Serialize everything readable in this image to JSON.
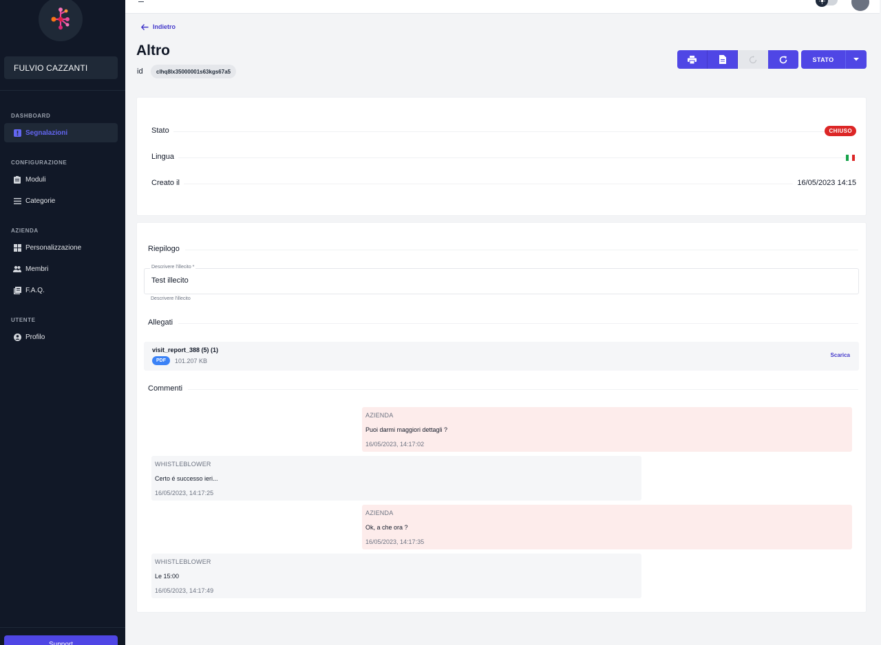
{
  "sidebar": {
    "user_name": "FULVIO CAZZANTI",
    "sections": [
      {
        "title": "DASHBOARD",
        "items": [
          {
            "label": "Segnalazioni",
            "icon": "alert-square-icon",
            "active": true
          }
        ]
      },
      {
        "title": "CONFIGURAZIONE",
        "items": [
          {
            "label": "Moduli",
            "icon": "clipboard-icon"
          },
          {
            "label": "Categorie",
            "icon": "list-icon"
          }
        ]
      },
      {
        "title": "AZIENDA",
        "items": [
          {
            "label": "Personalizzazione",
            "icon": "grid-icon"
          },
          {
            "label": "Membri",
            "icon": "users-icon"
          },
          {
            "label": "F.A.Q.",
            "icon": "book-icon"
          }
        ]
      },
      {
        "title": "UTENTE",
        "items": [
          {
            "label": "Profilo",
            "icon": "user-circle-icon"
          }
        ]
      }
    ],
    "support_label": "Support"
  },
  "header": {
    "back_label": "Indietro",
    "title": "Altro",
    "id_label": "id",
    "id_value": "clhq8lx35000001s63kgs67a5",
    "stato_label": "STATO"
  },
  "info": {
    "stato_label": "Stato",
    "stato_value": "CHIUSO",
    "lingua_label": "Lingua",
    "creato_label": "Creato il",
    "creato_value": "16/05/2023 14:15"
  },
  "riepilogo": {
    "title": "Riepilogo",
    "field_label": "Descrivere l'illecito *",
    "field_value": "Test illecito",
    "field_help": "Descrivere l'illecito"
  },
  "allegati": {
    "title": "Allegati",
    "file_name": "visit_report_388 (5) (1)",
    "file_type": "PDF",
    "file_size": "101.207 KB",
    "download_label": "Scarica"
  },
  "commenti": {
    "title": "Commenti",
    "items": [
      {
        "author": "AZIENDA",
        "text": "Puoi darmi maggiori dettagli ?",
        "time": "16/05/2023, 14:17:02"
      },
      {
        "author": "WHISTLEBLOWER",
        "text": "Certo é successo ieri...",
        "time": "16/05/2023, 14:17:25"
      },
      {
        "author": "AZIENDA",
        "text": "Ok, a che ora ?",
        "time": "16/05/2023, 14:17:35"
      },
      {
        "author": "WHISTLEBLOWER",
        "text": "Le 15:00",
        "time": "16/05/2023, 14:17:49"
      }
    ]
  },
  "colors": {
    "accent": "#4f46e5",
    "sidebar_bg": "#111827",
    "badge_closed": "#dc2626",
    "azienda_bg": "#fdeceb"
  }
}
